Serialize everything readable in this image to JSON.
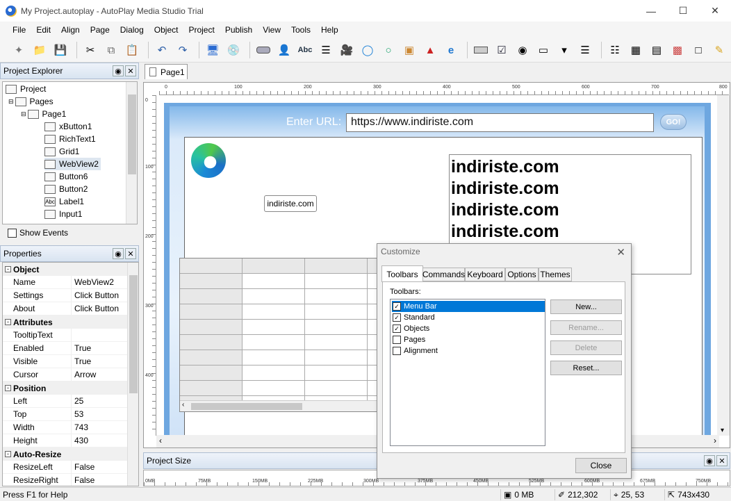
{
  "window": {
    "title": "My Project.autoplay - AutoPlay Media Studio Trial"
  },
  "menu": [
    "File",
    "Edit",
    "Align",
    "Page",
    "Dialog",
    "Object",
    "Project",
    "Publish",
    "View",
    "Tools",
    "Help"
  ],
  "explorer": {
    "title": "Project Explorer",
    "items": [
      "Project",
      "Pages",
      "Page1",
      "xButton1",
      "RichText1",
      "Grid1",
      "WebView2",
      "Button6",
      "Button2",
      "Label1",
      "Input1"
    ],
    "show_events": "Show Events"
  },
  "properties": {
    "title": "Properties",
    "cat_object": "Object",
    "cat_attributes": "Attributes",
    "cat_position": "Position",
    "cat_autoresize": "Auto-Resize",
    "rows": {
      "name": [
        "Name",
        "WebView2"
      ],
      "settings": [
        "Settings",
        "Click Button"
      ],
      "about": [
        "About",
        "Click Button"
      ],
      "tooltip": [
        "TooltipText",
        ""
      ],
      "enabled": [
        "Enabled",
        "True"
      ],
      "visible": [
        "Visible",
        "True"
      ],
      "cursor": [
        "Cursor",
        "Arrow"
      ],
      "left": [
        "Left",
        "25"
      ],
      "top": [
        "Top",
        "53"
      ],
      "width": [
        "Width",
        "743"
      ],
      "height": [
        "Height",
        "430"
      ],
      "resizeleft": [
        "ResizeLeft",
        "False"
      ],
      "resizeright": [
        "ResizeRight",
        "False"
      ]
    }
  },
  "doc_tab": "Page1",
  "ruler": {
    "top": [
      "0",
      "100",
      "200",
      "300",
      "400",
      "500",
      "600",
      "700",
      "800"
    ],
    "left": [
      "0",
      "100",
      "200",
      "300",
      "400"
    ]
  },
  "page": {
    "url_label": "Enter URL:",
    "url_value": "https://www.indiriste.com",
    "go_label": "GO!",
    "xbutton_label": "indiriste.com",
    "richtext_lines": [
      "indiriste.com",
      "indiriste.com",
      "indiriste.com",
      "indiriste.com"
    ]
  },
  "dialog": {
    "title": "Customize",
    "tabs": [
      "Toolbars",
      "Commands",
      "Keyboard",
      "Options",
      "Themes"
    ],
    "toolbars_label": "Toolbars:",
    "toolbars": [
      {
        "name": "Menu Bar",
        "checked": true
      },
      {
        "name": "Standard",
        "checked": true
      },
      {
        "name": "Objects",
        "checked": true
      },
      {
        "name": "Pages",
        "checked": false
      },
      {
        "name": "Alignment",
        "checked": false
      }
    ],
    "btn_new": "New...",
    "btn_rename": "Rename...",
    "btn_delete": "Delete",
    "btn_reset": "Reset...",
    "btn_close": "Close"
  },
  "project_size": {
    "title": "Project Size",
    "scale": [
      "0MB",
      "75MB",
      "150MB",
      "225MB",
      "300MB",
      "375MB",
      "450MB",
      "525MB",
      "600MB",
      "675MB",
      "750MB"
    ]
  },
  "status": {
    "help": "Press F1 for Help",
    "size": "0 MB",
    "memory": "212,302",
    "position": "25, 53",
    "dimensions": "743x430"
  }
}
